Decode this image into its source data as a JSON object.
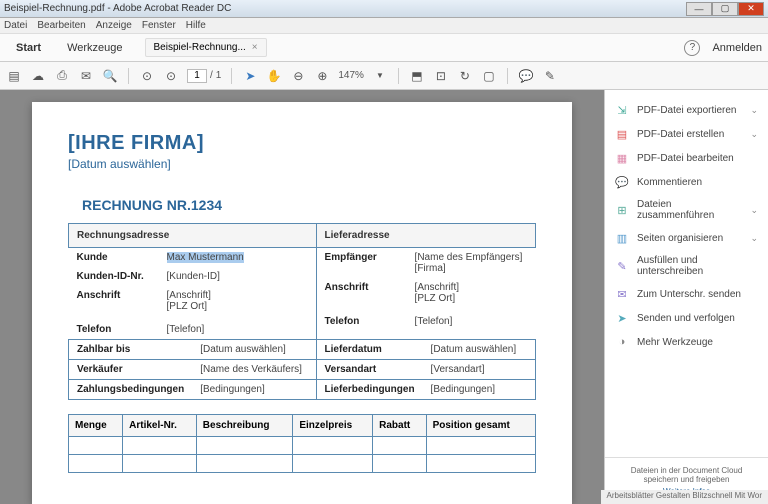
{
  "window": {
    "title": "Beispiel-Rechnung.pdf - Adobe Acrobat Reader DC"
  },
  "menu": {
    "file": "Datei",
    "edit": "Bearbeiten",
    "view": "Anzeige",
    "window": "Fenster",
    "help": "Hilfe"
  },
  "tabs": {
    "start": "Start",
    "tools": "Werkzeuge",
    "doc": "Beispiel-Rechnung...",
    "close": "×"
  },
  "login": "Anmelden",
  "toolbar": {
    "page_cur": "1",
    "page_sep": "/",
    "page_total": "1",
    "zoom": "147%"
  },
  "doc": {
    "company": "[IHRE FIRMA]",
    "date_sel": "[Datum auswählen]",
    "inv_title": "RECHNUNG NR.1234",
    "hdr_bill": "Rechnungsadresse",
    "hdr_ship": "Lieferadresse",
    "bill": {
      "l1": "Kunde",
      "v1": "Max Mustermann",
      "l2": "Kunden-ID-Nr.",
      "v2": "[Kunden-ID]",
      "l3": "Anschrift",
      "v3a": "[Anschrift]",
      "v3b": "[PLZ Ort]",
      "l4": "Telefon",
      "v4": "[Telefon]"
    },
    "ship": {
      "l1": "Empfänger",
      "v1a": "[Name des Empfängers]",
      "v1b": "[Firma]",
      "l2": "Anschrift",
      "v2a": "[Anschrift]",
      "v2b": "[PLZ Ort]",
      "l3": "Telefon",
      "v3": "[Telefon]"
    },
    "terms": {
      "l1": "Zahlbar bis",
      "v1": "[Datum auswählen]",
      "l2": "Verkäufer",
      "v2": "[Name des Verkäufers]",
      "l3": "Zahlungsbedingungen",
      "v3": "[Bedingungen]",
      "r1": "Lieferdatum",
      "rv1": "[Datum auswählen]",
      "r2": "Versandart",
      "rv2": "[Versandart]",
      "r3": "Lieferbedingungen",
      "rv3": "[Bedingungen]"
    },
    "cols": {
      "c1": "Menge",
      "c2": "Artikel-Nr.",
      "c3": "Beschreibung",
      "c4": "Einzelpreis",
      "c5": "Rabatt",
      "c6": "Position gesamt"
    }
  },
  "side": {
    "i1": "PDF-Datei exportieren",
    "i2": "PDF-Datei erstellen",
    "i3": "PDF-Datei bearbeiten",
    "i4": "Kommentieren",
    "i5": "Dateien zusammenführen",
    "i6": "Seiten organisieren",
    "i7": "Ausfüllen und unterschreiben",
    "i8": "Zum Unterschr. senden",
    "i9": "Senden und verfolgen",
    "i10": "Mehr Werkzeuge",
    "footer1": "Dateien in der Document Cloud speichern und freigeben",
    "footer2": "Weitere Infos"
  },
  "status": "Arbeitsblätter Gestalten Blitzschnell Mit Wor"
}
